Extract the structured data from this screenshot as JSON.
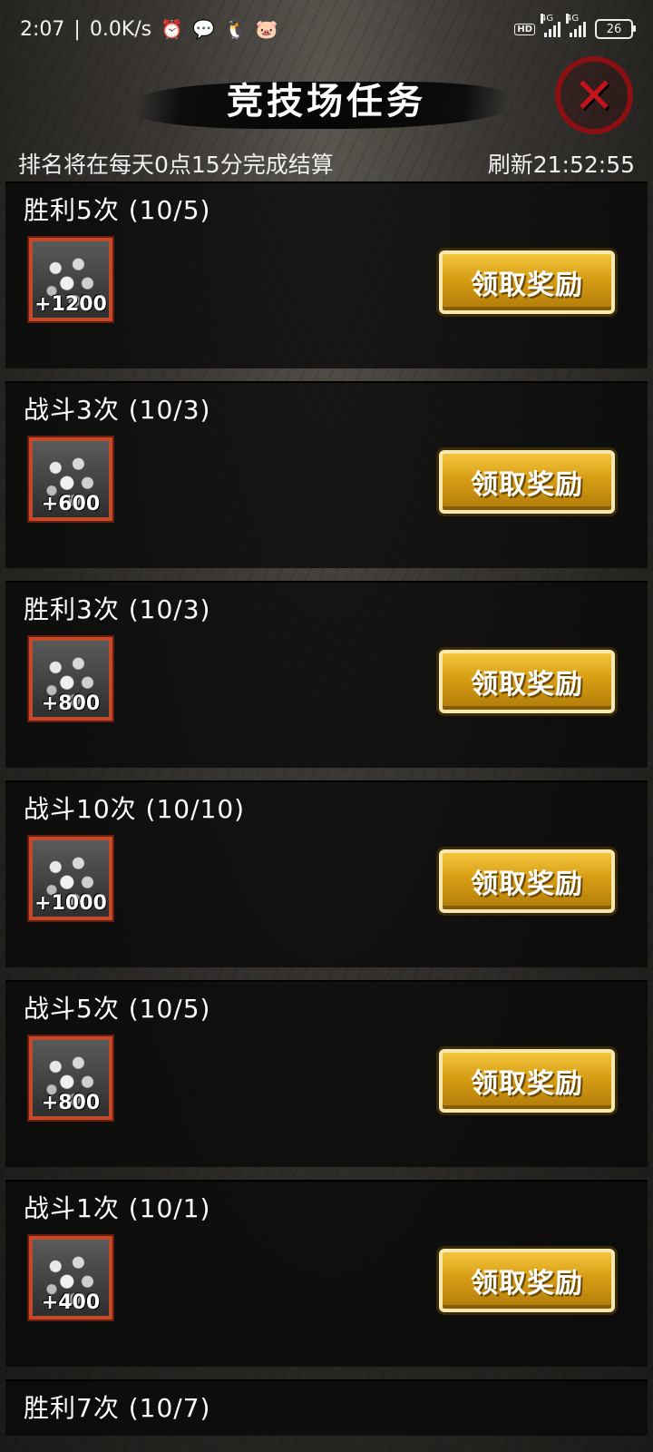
{
  "status_bar": {
    "time": "2:07",
    "speed": "0.0K/s",
    "net_label_1": "4G",
    "net_label_2": "4G",
    "hd": "HD",
    "battery": "26"
  },
  "header": {
    "title": "竞技场任务",
    "settlement_note": "排名将在每天0点15分完成结算",
    "refresh": "刷新21:52:55"
  },
  "tasks": [
    {
      "title": "胜利5次 (10/5)",
      "reward": "+1200",
      "button": "领取奖励"
    },
    {
      "title": "战斗3次 (10/3)",
      "reward": "+600",
      "button": "领取奖励"
    },
    {
      "title": "胜利3次 (10/3)",
      "reward": "+800",
      "button": "领取奖励"
    },
    {
      "title": "战斗10次 (10/10)",
      "reward": "+1000",
      "button": "领取奖励"
    },
    {
      "title": "战斗5次 (10/5)",
      "reward": "+800",
      "button": "领取奖励"
    },
    {
      "title": "战斗1次 (10/1)",
      "reward": "+400",
      "button": "领取奖励"
    },
    {
      "title": "胜利7次 (10/7)"
    }
  ],
  "colors": {
    "button_gold": "#d79d14",
    "reward_border": "#c24a2a",
    "close_red": "#c0141a"
  }
}
